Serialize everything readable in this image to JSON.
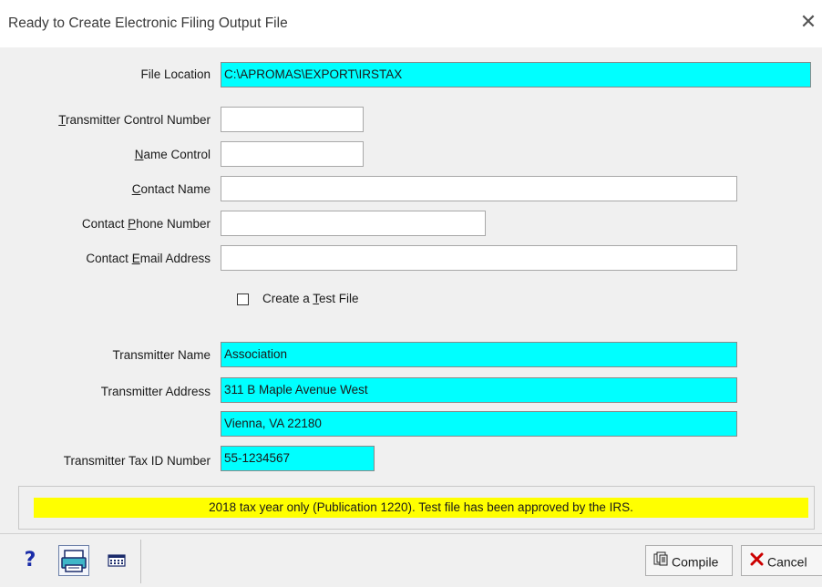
{
  "window": {
    "title": "Ready to Create Electronic Filing Output File",
    "close_glyph": "✕"
  },
  "form": {
    "file_location": {
      "label": "File Location",
      "value": "C:\\APROMAS\\EXPORT\\IRSTAX"
    },
    "transmitter_control_number": {
      "label_pre": "",
      "label_key": "T",
      "label_post": "ransmitter Control Number",
      "value": ""
    },
    "name_control": {
      "label_pre": "",
      "label_key": "N",
      "label_post": "ame Control",
      "value": ""
    },
    "contact_name": {
      "label_pre": "",
      "label_key": "C",
      "label_post": "ontact Name",
      "value": ""
    },
    "contact_phone": {
      "label_pre": "Contact ",
      "label_key": "P",
      "label_post": "hone Number",
      "value": ""
    },
    "contact_email": {
      "label_pre": "Contact ",
      "label_key": "E",
      "label_post": "mail Address",
      "value": ""
    },
    "test_file": {
      "label_pre": "Create a ",
      "label_key": "T",
      "label_post": "est File",
      "checked": false
    },
    "transmitter_name": {
      "label": "Transmitter Name",
      "value": "Association"
    },
    "transmitter_address": {
      "label": "Transmitter Address",
      "line1": "311 B Maple Avenue West",
      "line2": "Vienna, VA 22180"
    },
    "transmitter_tax_id": {
      "label": "Transmitter Tax ID Number",
      "value": "55-1234567"
    }
  },
  "notice": "2018 tax year only (Publication 1220). Test file has been approved by the IRS.",
  "toolbar": {
    "help_glyph": "?",
    "help_icon": "help-icon",
    "print_icon": "printer-icon",
    "pad_icon": "calculator-icon",
    "compile_label": "Compile",
    "cancel_label": "Cancel"
  },
  "colors": {
    "highlight_field": "#00ffff",
    "notice_bg": "#ffff00",
    "cancel_x": "#cc0000"
  }
}
